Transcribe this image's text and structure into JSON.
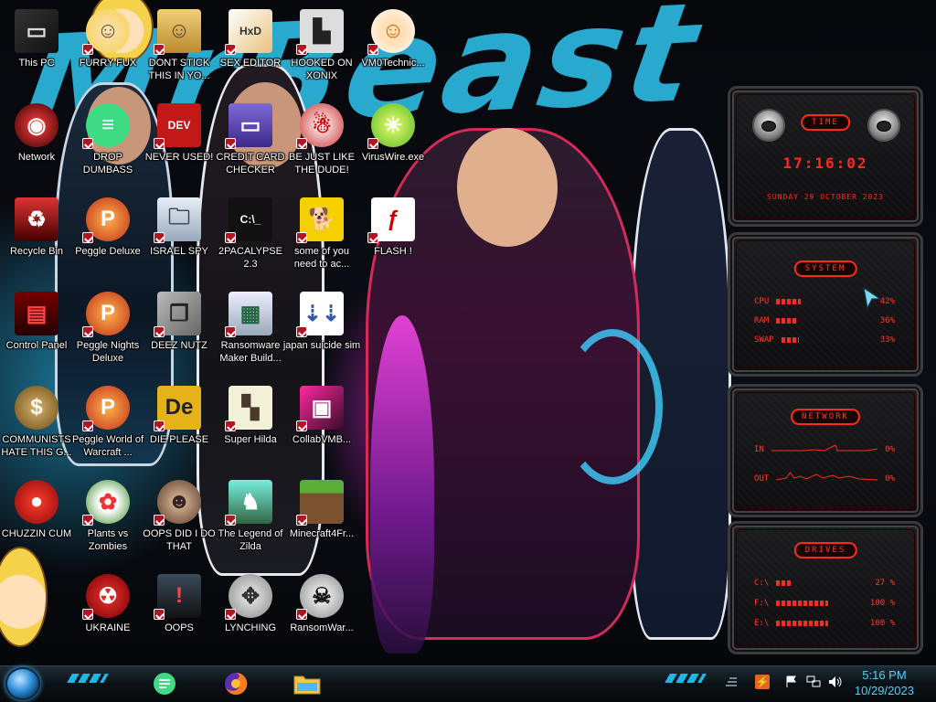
{
  "wallpaper": {
    "title": "MrBeast"
  },
  "desktop_icons": [
    {
      "label": "This PC",
      "icon": "computer-icon",
      "name": "icon-this-pc"
    },
    {
      "label": "Network",
      "icon": "network-icon",
      "name": "icon-network"
    },
    {
      "label": "Recycle Bin",
      "icon": "recycle-bin-icon",
      "name": "icon-recycle-bin"
    },
    {
      "label": "Control Panel",
      "icon": "control-panel-icon",
      "name": "icon-control-panel"
    },
    {
      "label": "COMMUNISTS HATE THIS G...",
      "icon": "money-bag-icon",
      "name": "icon-communists"
    },
    {
      "label": "CHUZZIN CUM",
      "icon": "chuzzle-icon",
      "name": "icon-chuzzin"
    },
    {
      "label": "FURRY FUX",
      "icon": "cartoon-girl-icon",
      "name": "icon-furry-fux"
    },
    {
      "label": "DROP DUMBASS",
      "icon": "chat-app-icon",
      "name": "icon-drop"
    },
    {
      "label": "Peggle Deluxe",
      "icon": "peggle-icon",
      "name": "icon-peggle-deluxe"
    },
    {
      "label": "Peggle Nights Deluxe",
      "icon": "peggle-icon",
      "name": "icon-peggle-nights"
    },
    {
      "label": "Peggle World of Warcraft ...",
      "icon": "peggle-icon",
      "name": "icon-peggle-wow"
    },
    {
      "label": "Plants vs Zombies",
      "icon": "flower-icon",
      "name": "icon-pvz"
    },
    {
      "label": "UKRAINE",
      "icon": "radiation-icon",
      "name": "icon-ukraine"
    },
    {
      "label": "DONT STICK THIS IN YO...",
      "icon": "document-icon",
      "name": "icon-dont-stick"
    },
    {
      "label": "NEVER USED!",
      "icon": "dev-cpp-icon",
      "name": "icon-never-used"
    },
    {
      "label": "ISRAEL SPY",
      "icon": "folder-remote-icon",
      "name": "icon-israel-spy"
    },
    {
      "label": "DEEZ NUTZ",
      "icon": "windows-stack-icon",
      "name": "icon-deez-nutz"
    },
    {
      "label": "DIE PLEASE",
      "icon": "de-app-icon",
      "name": "icon-die-please"
    },
    {
      "label": "OOPS DID I DO THAT",
      "icon": "portrait-icon",
      "name": "icon-oops-did-i"
    },
    {
      "label": "OOPS",
      "icon": "monitor-warning-icon",
      "name": "icon-oops"
    },
    {
      "label": "SEX EDITOR",
      "icon": "hex-editor-icon",
      "name": "icon-sex-editor"
    },
    {
      "label": "CREDIT CARD CHECKER",
      "icon": "credit-card-icon",
      "name": "icon-credit-card"
    },
    {
      "label": "2PACALYPSE 2.3",
      "icon": "terminal-icon",
      "name": "icon-2pacalypse"
    },
    {
      "label": "Ransomware Maker Build...",
      "icon": "window-app-icon",
      "name": "icon-ransomware-maker"
    },
    {
      "label": "Super Hilda",
      "icon": "pixel-art-icon",
      "name": "icon-super-hilda"
    },
    {
      "label": "The Legend of Zilda",
      "icon": "pixel-hero-icon",
      "name": "icon-legend-zilda"
    },
    {
      "label": "LYNCHING",
      "icon": "network-globe-icon",
      "name": "icon-lynching"
    },
    {
      "label": "HOOKED ON XONIX",
      "icon": "xonix-icon",
      "name": "icon-xonix"
    },
    {
      "label": "BE JUST LIKE THE DUDE!",
      "icon": "santa-icon",
      "name": "icon-the-dude"
    },
    {
      "label": "some of you need to ac...",
      "icon": "dog-icon",
      "name": "icon-some-of-you"
    },
    {
      "label": "japan suicide sim",
      "icon": "installer-icon",
      "name": "icon-japan-sim"
    },
    {
      "label": "CollabVMB...",
      "icon": "collabvm-icon",
      "name": "icon-collabvm"
    },
    {
      "label": "Minecraft4Fr...",
      "icon": "grass-block-icon",
      "name": "icon-minecraft"
    },
    {
      "label": "RansomWar...",
      "icon": "skull-icon",
      "name": "icon-ransomware"
    },
    {
      "label": "VM0Technic...",
      "icon": "doctor-icon",
      "name": "icon-vm0"
    },
    {
      "label": "VirusWire.exe",
      "icon": "lime-icon",
      "name": "icon-viruswire"
    },
    {
      "label": "FLASH !",
      "icon": "flash-file-icon",
      "name": "icon-flash"
    }
  ],
  "gadgets": {
    "clock": {
      "title": "TIME",
      "time": "17:16:02",
      "date": "SUNDAY 29 OCTOBER 2023"
    },
    "system": {
      "title": "SYSTEM",
      "rows": [
        {
          "label": "CPU",
          "value": "42%",
          "percent": 42
        },
        {
          "label": "RAM",
          "value": "36%",
          "percent": 36
        },
        {
          "label": "SWAP",
          "value": "33%",
          "percent": 33
        }
      ]
    },
    "network": {
      "title": "NETWORK",
      "rows": [
        {
          "label": "IN",
          "value": "0%"
        },
        {
          "label": "OUT",
          "value": "0%"
        }
      ]
    },
    "drives": {
      "title": "DRIVES",
      "rows": [
        {
          "label": "C:\\",
          "value": "27 %",
          "percent": 27
        },
        {
          "label": "F:\\",
          "value": "100 %",
          "percent": 100
        },
        {
          "label": "E:\\",
          "value": "100 %",
          "percent": 100
        }
      ]
    }
  },
  "taskbar": {
    "start": "start-orb-icon",
    "apps": [
      {
        "name": "taskbar-app-chat",
        "icon": "chat-app-icon",
        "color": "#3ddc84"
      },
      {
        "name": "taskbar-app-firefox",
        "icon": "firefox-icon",
        "color": "#ff7a1a"
      },
      {
        "name": "taskbar-app-explorer",
        "icon": "file-explorer-icon",
        "color": "#f1c84b"
      }
    ],
    "tray": [
      "avast-icon",
      "flag-icon",
      "network-tray-icon",
      "volume-icon"
    ],
    "time": "5:16 PM",
    "date": "10/29/2023"
  }
}
